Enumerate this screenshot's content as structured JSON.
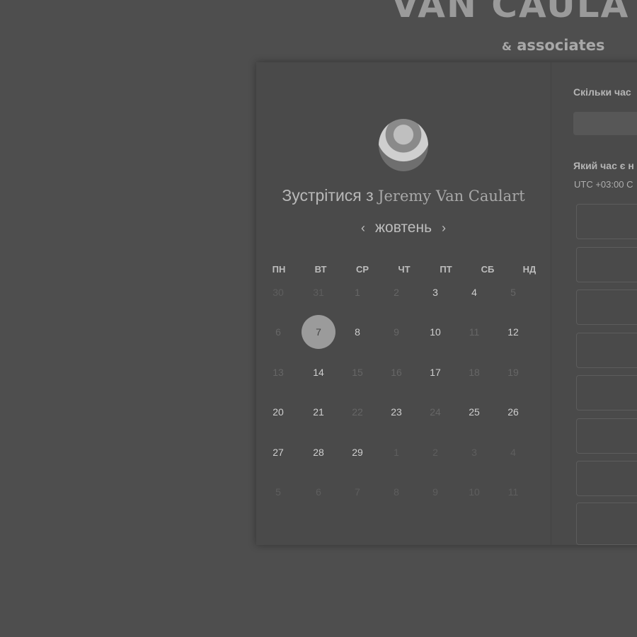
{
  "brand": {
    "title": "VAN CAULA",
    "amp": "&",
    "subtitle": "associates"
  },
  "meet": {
    "prefix": "Зустрітися з",
    "person": "Jeremy Van Caulart"
  },
  "calendar": {
    "month": "жовтень",
    "prev_arrow": "‹",
    "next_arrow": "›",
    "weekdays": [
      "ПН",
      "ВТ",
      "СР",
      "ЧТ",
      "ПТ",
      "СБ",
      "НД"
    ],
    "weeks": [
      [
        {
          "d": "30",
          "s": "outside"
        },
        {
          "d": "31",
          "s": "outside"
        },
        {
          "d": "1",
          "s": "unavailable"
        },
        {
          "d": "2",
          "s": "unavailable"
        },
        {
          "d": "3",
          "s": "available"
        },
        {
          "d": "4",
          "s": "available"
        },
        {
          "d": "5",
          "s": "unavailable"
        }
      ],
      [
        {
          "d": "6",
          "s": "unavailable"
        },
        {
          "d": "7",
          "s": "selected"
        },
        {
          "d": "8",
          "s": "available"
        },
        {
          "d": "9",
          "s": "unavailable"
        },
        {
          "d": "10",
          "s": "available"
        },
        {
          "d": "11",
          "s": "unavailable"
        },
        {
          "d": "12",
          "s": "available"
        }
      ],
      [
        {
          "d": "13",
          "s": "unavailable"
        },
        {
          "d": "14",
          "s": "available"
        },
        {
          "d": "15",
          "s": "unavailable"
        },
        {
          "d": "16",
          "s": "unavailable"
        },
        {
          "d": "17",
          "s": "available"
        },
        {
          "d": "18",
          "s": "unavailable"
        },
        {
          "d": "19",
          "s": "unavailable"
        }
      ],
      [
        {
          "d": "20",
          "s": "available"
        },
        {
          "d": "21",
          "s": "available"
        },
        {
          "d": "22",
          "s": "unavailable"
        },
        {
          "d": "23",
          "s": "available"
        },
        {
          "d": "24",
          "s": "unavailable"
        },
        {
          "d": "25",
          "s": "available"
        },
        {
          "d": "26",
          "s": "available"
        }
      ],
      [
        {
          "d": "27",
          "s": "available"
        },
        {
          "d": "28",
          "s": "available"
        },
        {
          "d": "29",
          "s": "available"
        },
        {
          "d": "1",
          "s": "outside"
        },
        {
          "d": "2",
          "s": "outside"
        },
        {
          "d": "3",
          "s": "outside"
        },
        {
          "d": "4",
          "s": "outside"
        }
      ],
      [
        {
          "d": "5",
          "s": "outside"
        },
        {
          "d": "6",
          "s": "outside"
        },
        {
          "d": "7",
          "s": "outside"
        },
        {
          "d": "8",
          "s": "outside"
        },
        {
          "d": "9",
          "s": "outside"
        },
        {
          "d": "10",
          "s": "outside"
        },
        {
          "d": "11",
          "s": "outside"
        }
      ]
    ]
  },
  "right": {
    "duration_label": "Скільки час",
    "time_label": "Який час є н",
    "timezone": "UTC +03:00 С",
    "slot_count": 7
  }
}
